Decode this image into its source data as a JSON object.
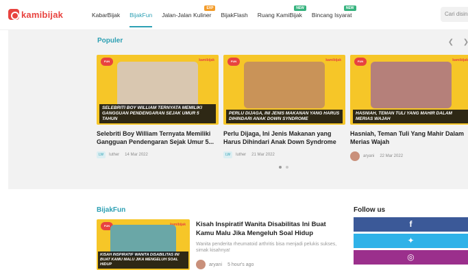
{
  "header": {
    "logo_text": "kamibijak",
    "nav": [
      {
        "label": "KabarBijak",
        "active": false,
        "badge": ""
      },
      {
        "label": "BijakFun",
        "active": true,
        "badge": ""
      },
      {
        "label": "Jalan-Jalan Kuliner",
        "active": false,
        "badge": "EXP"
      },
      {
        "label": "BijakFlash",
        "active": false,
        "badge": ""
      },
      {
        "label": "Ruang KamiBijak",
        "active": false,
        "badge": "NEW"
      },
      {
        "label": "Bincang Isyarat",
        "active": false,
        "badge": "NEW"
      }
    ],
    "badge_colors": {
      "EXP": "#f39c2a",
      "NEW": "#36b37e"
    },
    "search_placeholder": "Cari disini"
  },
  "populer": {
    "title": "Populer",
    "prev_icon": "chevron-left-icon",
    "next_icon": "chevron-right-icon",
    "cards": [
      {
        "caption": "SELEBRITI BOY WILLIAM TERNYATA MEMILIKI GANGGUAN PENDENGARAN SEJAK UMUR 5 TAHUN",
        "title": "Selebriti Boy William Ternyata Memiliki Gangguan Pendengaran Sejak Umur 5...",
        "badge": "LW",
        "author": "luther",
        "date": "14 Mar 2022",
        "photo_color": "#d9c7b0"
      },
      {
        "caption": "PERLU DIJAGA, INI JENIS MAKANAN YANG HARUS DIHINDARI ANAK DOWN SYNDROME",
        "title": "Perlu Dijaga, Ini Jenis Makanan yang Harus Dihindari Anak Down Syndrome",
        "badge": "LW",
        "author": "luther",
        "date": "21 Mar 2022",
        "photo_color": "#c99358"
      },
      {
        "caption": "HASNIAH, TEMAN TULI YANG MAHIR DALAM MERIAS WAJAH",
        "title": "Hasniah, Teman Tuli Yang Mahir Dalam Merias Wajah",
        "badge": "",
        "author": "aryani",
        "date": "22 Mar 2022",
        "photo_color": "#b5807a"
      }
    ],
    "slide_index": 1,
    "slide_count": 2
  },
  "bijakfun": {
    "title": "BijakFun",
    "article": {
      "caption": "KISAH INSPIRATIF WANITA DISABILITAS INI BUAT KAMU MALU JIKA MENGELUH SOAL HIDUP",
      "title": "Kisah Inspiratif Wanita Disabilitas Ini Buat Kamu Malu Jika Mengeluh Soal Hidup",
      "description": "Wanita penderita rheumatoid arthritis bisa menjadi pelukis sukses, simak kisahnya!",
      "author": "aryani",
      "time": "5 hour's ago"
    }
  },
  "follow": {
    "title": "Follow us",
    "items": [
      {
        "name": "facebook-icon",
        "glyph": "f",
        "color": "#3b5998"
      },
      {
        "name": "twitter-icon",
        "glyph": "✦",
        "color": "#2fb2e8"
      },
      {
        "name": "instagram-icon",
        "glyph": "◎",
        "color": "#9b2f8c"
      }
    ]
  }
}
